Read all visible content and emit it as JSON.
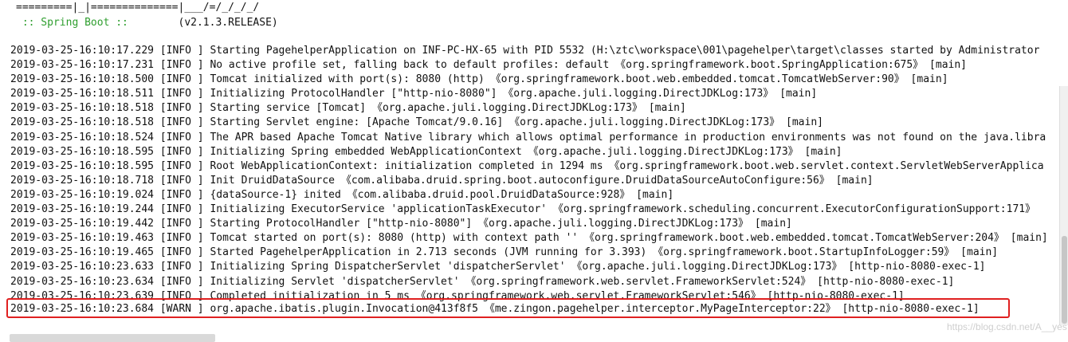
{
  "banner": {
    "top_line": "=========|_|==============|___/=/_/_/_/",
    "spring_label": " :: Spring Boot :: ",
    "spring_version": "       (v2.1.3.RELEASE)"
  },
  "log_lines": [
    "2019-03-25-16:10:17.229 [INFO ] Starting PagehelperApplication on INF-PC-HX-65 with PID 5532 (H:\\ztc\\workspace\\001\\pagehelper\\target\\classes started by Administrator",
    "2019-03-25-16:10:17.231 [INFO ] No active profile set, falling back to default profiles: default 《org.springframework.boot.SpringApplication:675》 [main]",
    "2019-03-25-16:10:18.500 [INFO ] Tomcat initialized with port(s): 8080 (http) 《org.springframework.boot.web.embedded.tomcat.TomcatWebServer:90》 [main]",
    "2019-03-25-16:10:18.511 [INFO ] Initializing ProtocolHandler [\"http-nio-8080\"] 《org.apache.juli.logging.DirectJDKLog:173》 [main]",
    "2019-03-25-16:10:18.518 [INFO ] Starting service [Tomcat] 《org.apache.juli.logging.DirectJDKLog:173》 [main]",
    "2019-03-25-16:10:18.518 [INFO ] Starting Servlet engine: [Apache Tomcat/9.0.16] 《org.apache.juli.logging.DirectJDKLog:173》 [main]",
    "2019-03-25-16:10:18.524 [INFO ] The APR based Apache Tomcat Native library which allows optimal performance in production environments was not found on the java.libra",
    "2019-03-25-16:10:18.595 [INFO ] Initializing Spring embedded WebApplicationContext 《org.apache.juli.logging.DirectJDKLog:173》 [main]",
    "2019-03-25-16:10:18.595 [INFO ] Root WebApplicationContext: initialization completed in 1294 ms 《org.springframework.boot.web.servlet.context.ServletWebServerApplica",
    "2019-03-25-16:10:18.718 [INFO ] Init DruidDataSource 《com.alibaba.druid.spring.boot.autoconfigure.DruidDataSourceAutoConfigure:56》 [main]",
    "2019-03-25-16:10:19.024 [INFO ] {dataSource-1} inited 《com.alibaba.druid.pool.DruidDataSource:928》 [main]",
    "2019-03-25-16:10:19.244 [INFO ] Initializing ExecutorService 'applicationTaskExecutor' 《org.springframework.scheduling.concurrent.ExecutorConfigurationSupport:171》",
    "2019-03-25-16:10:19.442 [INFO ] Starting ProtocolHandler [\"http-nio-8080\"] 《org.apache.juli.logging.DirectJDKLog:173》 [main]",
    "2019-03-25-16:10:19.463 [INFO ] Tomcat started on port(s): 8080 (http) with context path '' 《org.springframework.boot.web.embedded.tomcat.TomcatWebServer:204》 [main]",
    "2019-03-25-16:10:19.465 [INFO ] Started PagehelperApplication in 2.713 seconds (JVM running for 3.393) 《org.springframework.boot.StartupInfoLogger:59》 [main]",
    "2019-03-25-16:10:23.633 [INFO ] Initializing Spring DispatcherServlet 'dispatcherServlet' 《org.apache.juli.logging.DirectJDKLog:173》 [http-nio-8080-exec-1]",
    "2019-03-25-16:10:23.634 [INFO ] Initializing Servlet 'dispatcherServlet' 《org.springframework.web.servlet.FrameworkServlet:524》 [http-nio-8080-exec-1]",
    "2019-03-25-16:10:23.639 [INFO ] Completed initialization in 5 ms 《org.springframework.web.servlet.FrameworkServlet:546》 [http-nio-8080-exec-1]"
  ],
  "warn_line": "2019-03-25-16:10:23.684 [WARN ] org.apache.ibatis.plugin.Invocation@413f8f5 《me.zingon.pagehelper.interceptor.MyPageInterceptor:22》 [http-nio-8080-exec-1]",
  "watermark": "https://blog.csdn.net/A__yes",
  "colors": {
    "highlight_border": "#e02020",
    "spring_green": "#2e9e2e"
  }
}
